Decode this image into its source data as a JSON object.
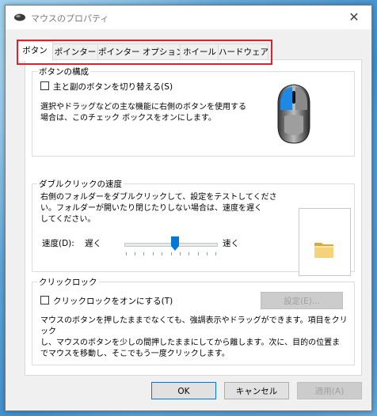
{
  "window": {
    "title": "マウスのプロパティ",
    "close_glyph": "✕"
  },
  "tabs": [
    {
      "label": "ボタン",
      "active": true
    },
    {
      "label": "ポインター",
      "active": false
    },
    {
      "label": "ポインター オプション",
      "active": false
    },
    {
      "label": "ホイール",
      "active": false
    },
    {
      "label": "ハードウェア",
      "active": false
    }
  ],
  "button_config": {
    "title": "ボタンの構成",
    "checkbox_label": "主と副のボタンを切り替える(S)",
    "checked": false,
    "description_line1": "選択やドラッグなどの主な機能に右側のボタンを使用する",
    "description_line2": "場合は、このチェック ボックスをオンにします。"
  },
  "double_click": {
    "title": "ダブルクリックの速度",
    "description_line1": "右側のフォルダーをダブルクリックして、設定をテストしてくださ",
    "description_line2": "い。フォルダーが開いたり閉じたりしない場合は、速度を遅く",
    "description_line3": "してください。",
    "speed_label": "速度(D):",
    "slow_label": "遅く",
    "fast_label": "速く",
    "speed_value_fraction": 0.55
  },
  "click_lock": {
    "title": "クリックロック",
    "checkbox_label": "クリックロックをオンにする(T)",
    "checked": false,
    "settings_button": "設定(E)...",
    "description_line1": "マウスのボタンを押したままでなくても、強調表示やドラッグができます。項目をクリック",
    "description_line2": "し、マウスのボタンを少しの間押したままにしてから離します。次に、目的の位置ま",
    "description_line3": "でマウスを移動し、そこでもう一度クリックします。"
  },
  "footer": {
    "ok": "OK",
    "cancel": "キャンセル",
    "apply": "適用(A)"
  },
  "colors": {
    "highlight": "#e0202a",
    "accent": "#0078d7",
    "mouse_button": "#1e88e5"
  },
  "icons": [
    "mouse-icon",
    "mouse-illustration",
    "folder-icon",
    "close-icon"
  ]
}
